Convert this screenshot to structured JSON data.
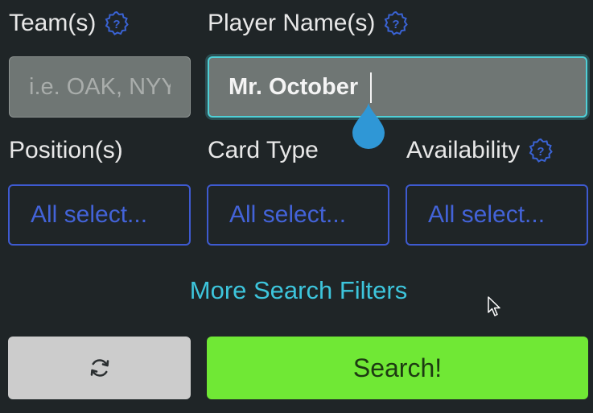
{
  "teams": {
    "label": "Team(s)",
    "placeholder": "i.e. OAK, NYY",
    "value": ""
  },
  "players": {
    "label": "Player Name(s)",
    "value": "Mr. October"
  },
  "position": {
    "label": "Position(s)",
    "selected": "All select..."
  },
  "card_type": {
    "label": "Card Type",
    "selected": "All select..."
  },
  "availability": {
    "label": "Availability",
    "selected": "All select..."
  },
  "more_filters_label": "More Search Filters",
  "search_label": "Search!",
  "colors": {
    "background": "#1f2527",
    "input_focus_border": "#4fd0d7",
    "select_border": "#3e5ad0",
    "link": "#3dc5dc",
    "search_button": "#70e835",
    "reset_button": "#cccccc"
  },
  "icons": {
    "help": "question-circle-icon",
    "reset": "refresh-icon",
    "drag": "text-selection-handle-icon",
    "pointer": "mouse-pointer-icon"
  }
}
